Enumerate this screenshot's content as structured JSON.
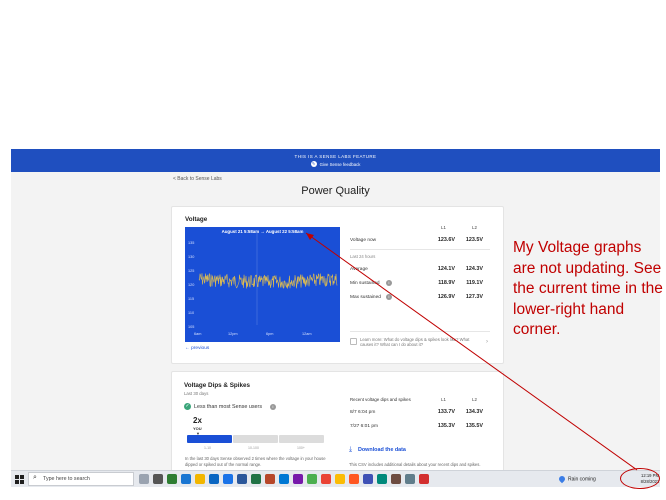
{
  "banner": {
    "label": "THIS IS A SENSE LABS FEATURE",
    "feedback": "Give Sense feedback"
  },
  "nav": {
    "back": "< Back to Sense Labs"
  },
  "page": {
    "title": "Power Quality"
  },
  "voltage": {
    "heading": "Voltage",
    "range": "August 21 5:58am → August 22 5:58am",
    "y_ticks": [
      "135",
      "130",
      "125",
      "120",
      "115",
      "110",
      "105"
    ],
    "x_ticks": [
      "6am",
      "12pm",
      "6pm",
      "12am"
    ],
    "previous": "← previous",
    "col_l1": "L1",
    "col_l2": "L2",
    "now_label": "Voltage now",
    "now_l1": "123.6V",
    "now_l2": "123.5V",
    "last24": "Last 24 hours",
    "avg_label": "Average",
    "avg_l1": "124.1V",
    "avg_l2": "124.3V",
    "min_label": "Min sustained",
    "min_l1": "118.9V",
    "min_l2": "119.1V",
    "max_label": "Max sustained",
    "max_l1": "126.9V",
    "max_l2": "127.3V",
    "learn": "Learn more: What do voltage dips & spikes look like? What causes it? What can I do about it?"
  },
  "dips": {
    "heading": "Voltage Dips & Spikes",
    "period": "Last 30 days",
    "comparison": "Less than most Sense users",
    "count": "2x",
    "you": "YOU",
    "scale": [
      "1-10",
      "10-100",
      "100+"
    ],
    "desc": "In the last 30 days Sense observed 2 times where the voltage in your house dipped or spiked out of the normal range.",
    "recent_label": "Recent voltage dips and spikes",
    "col_l1": "L1",
    "col_l2": "L2",
    "rows": [
      {
        "time": "8/7 6:04 pm",
        "l1": "133.7V",
        "l2": "134.3V"
      },
      {
        "time": "7/27 6:01 pm",
        "l1": "135.3V",
        "l2": "135.5V"
      }
    ],
    "download": "Download the data",
    "csv": "This CSV includes additional details about your recent dips and spikes."
  },
  "annotation": "My Voltage graphs are not updating. See the current time in the lower-right hand corner.",
  "taskbar": {
    "search_placeholder": "Type here to search",
    "weather": "Rain coming",
    "time": "12:19 PM",
    "date": "8/28/2022"
  },
  "colors": {
    "accent": "#1a4fd6",
    "banner": "#1f4fbf",
    "annotation": "#c00000",
    "voltage_line": "#e8c24a"
  }
}
